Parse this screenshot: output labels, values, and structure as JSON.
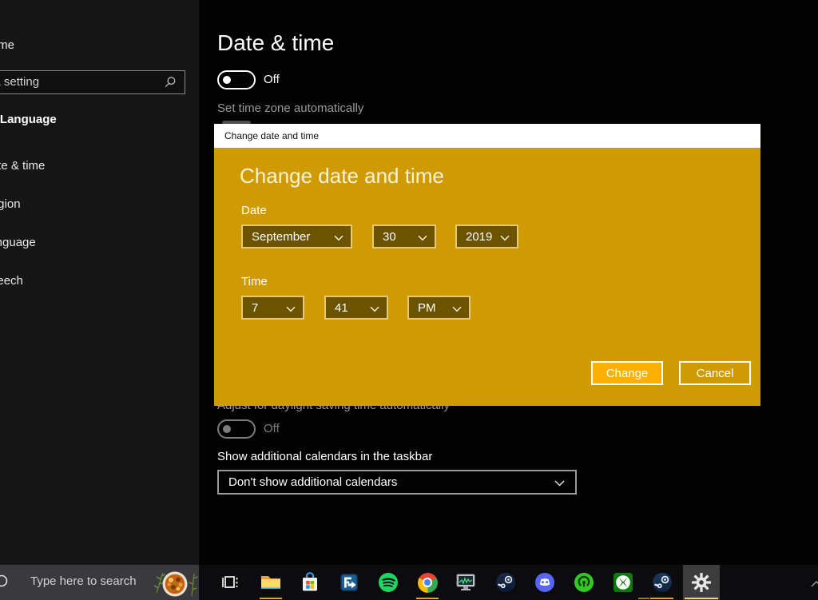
{
  "sidebar": {
    "home_label": "Home",
    "search_placeholder": "Find a setting",
    "section_title": "Time & Language",
    "items": [
      {
        "label": "Date & time"
      },
      {
        "label": "Region"
      },
      {
        "label": "Language"
      },
      {
        "label": "Speech"
      }
    ]
  },
  "main": {
    "title": "Date & time",
    "set_time_automatically_state": "Off",
    "set_timezone_label": "Set time zone automatically",
    "dst_label": "Adjust for daylight saving time automatically",
    "dst_state": "Off",
    "calendars_label": "Show additional calendars in the taskbar",
    "calendars_value": "Don't show additional calendars"
  },
  "dialog": {
    "window_title": "Change date and time",
    "heading": "Change date and time",
    "date_section_label": "Date",
    "month": "September",
    "day": "30",
    "year": "2019",
    "time_section_label": "Time",
    "hour": "7",
    "minute": "41",
    "meridiem": "PM",
    "primary_button": "Change",
    "secondary_button": "Cancel"
  },
  "taskbar": {
    "search_placeholder": "Type here to search",
    "icons": [
      "search",
      "seasonal-doodle",
      "task-view",
      "file-explorer",
      "microsoft-store",
      "blue-arrow-app",
      "spotify",
      "chrome",
      "system-monitor",
      "steam",
      "discord",
      "green-spiral-app",
      "xbox",
      "steam-2",
      "settings"
    ],
    "running_apps": [
      "file-explorer",
      "chrome",
      "steam-2",
      "settings"
    ],
    "active_app": "settings"
  },
  "colors": {
    "dialog_gold": "#CF9A02",
    "primary_button_gold": "#FDB004",
    "dropdown_fill": "#6B5300",
    "dropdown_border": "#E6C878",
    "running_indicator": "#D8A33C",
    "taskbar_search_bg": "#3A3A3E"
  }
}
